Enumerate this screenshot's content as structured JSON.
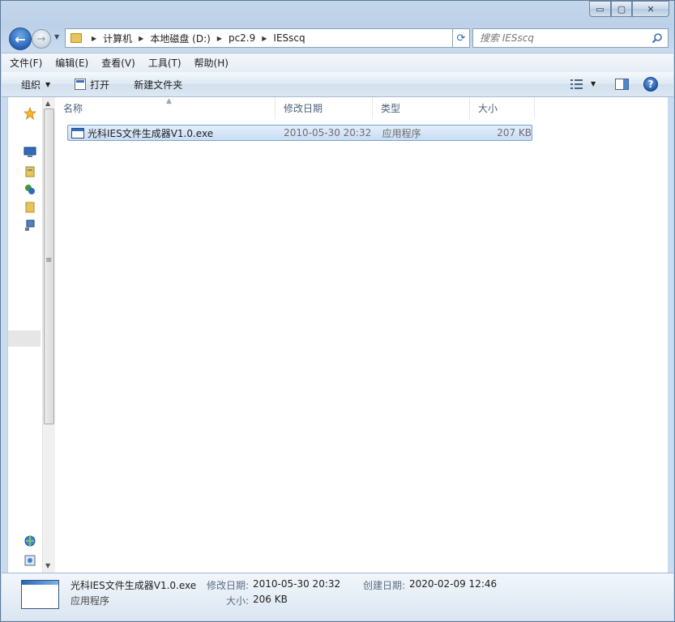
{
  "window": {
    "caption_buttons": {
      "minimize": "▭",
      "maximize": "▢",
      "close": "✕"
    }
  },
  "nav": {
    "back_glyph": "←",
    "forward_glyph": "→",
    "breadcrumbs": [
      "计算机",
      "本地磁盘 (D:)",
      "pc2.9",
      "IESscq"
    ],
    "search_placeholder": "搜索 IESscq"
  },
  "menu": {
    "items": [
      "文件(F)",
      "编辑(E)",
      "查看(V)",
      "工具(T)",
      "帮助(H)"
    ]
  },
  "toolbar": {
    "organize_label": "组织",
    "open_label": "打开",
    "new_folder_label": "新建文件夹",
    "help_glyph": "?"
  },
  "columns": [
    "名称",
    "修改日期",
    "类型",
    "大小"
  ],
  "files": [
    {
      "name": "光科IES文件生成器V1.0.exe",
      "modified": "2010-05-30 20:32",
      "type": "应用程序",
      "size": "207 KB",
      "selected": true
    }
  ],
  "details": {
    "name": "光科IES文件生成器V1.0.exe",
    "type": "应用程序",
    "modified_label": "修改日期:",
    "modified_value": "2010-05-30 20:32",
    "created_label": "创建日期:",
    "created_value": "2020-02-09 12:46",
    "size_label": "大小:",
    "size_value": "206 KB"
  },
  "colors": {
    "selection": "#c9ddf4",
    "selection_border": "#7da2ce",
    "frame": "#bcd1e8"
  }
}
